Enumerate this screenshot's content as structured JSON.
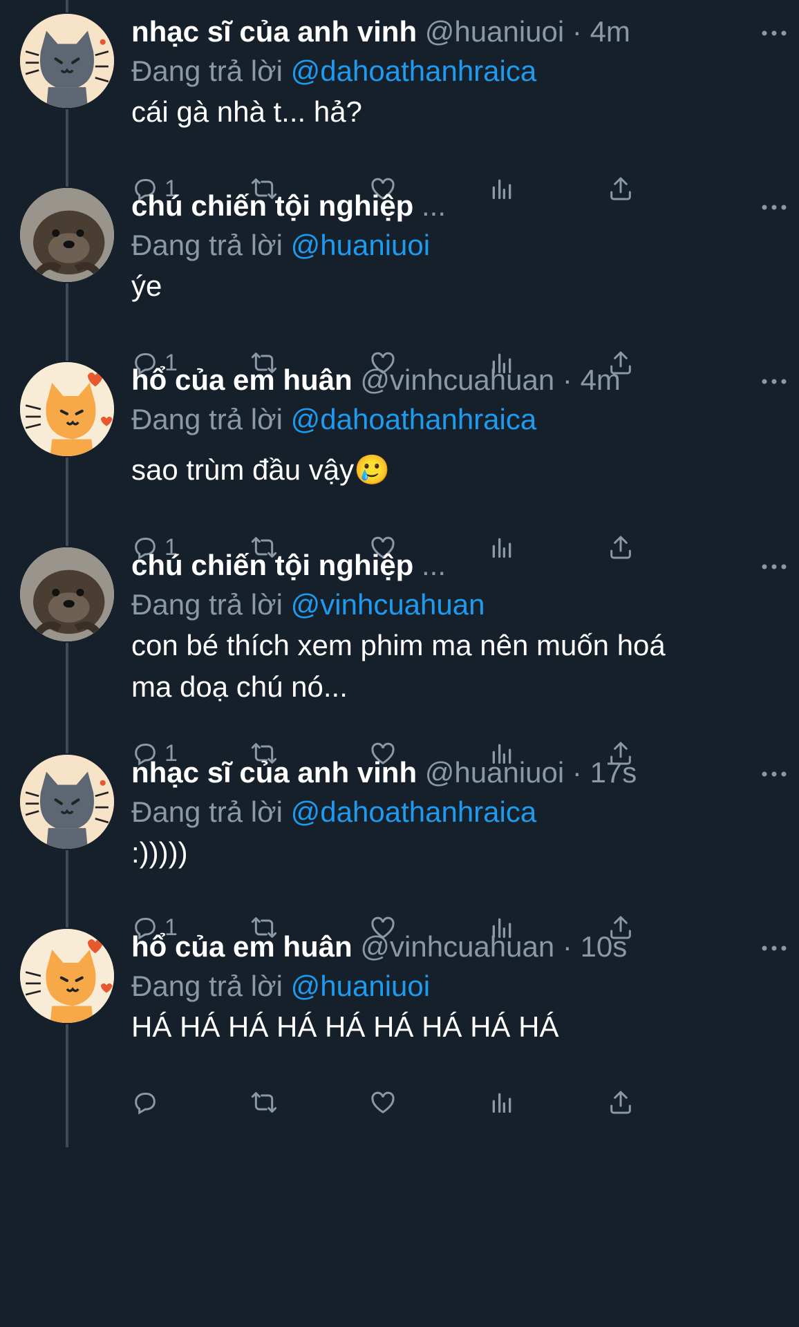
{
  "theme": {
    "background": "#15202b",
    "text": "#ffffff",
    "muted": "#8b98a5",
    "link": "#1d9bf0"
  },
  "tweets": [
    {
      "display_name": "nhạc sĩ của anh vinh",
      "handle": "@huaniuoi",
      "separator": "·",
      "time": "4m",
      "reply_prefix": "Đang trả lời",
      "reply_to": "@dahoathanhraica",
      "lines": [
        "cái gà nhà t... hả?"
      ],
      "reply_count": "1",
      "avatar": "gray-cat-avatar"
    },
    {
      "display_name": "chú chiến tội nghiệp",
      "handle": "...",
      "separator": "",
      "time": "",
      "reply_prefix": "Đang trả lời",
      "reply_to": "@huaniuoi",
      "lines": [
        "ýe"
      ],
      "reply_count": "1",
      "avatar": "otter-avatar"
    },
    {
      "display_name": "hổ của em huân",
      "handle": "@vinhcuahuan",
      "separator": "·",
      "time": "4m",
      "reply_prefix": "Đang trả lời",
      "reply_to": "@dahoathanhraica",
      "lines": [
        "sao trùm đầu vậy🥲"
      ],
      "reply_count": "1",
      "avatar": "orange-cat-avatar"
    },
    {
      "display_name": "chú chiến tội nghiệp",
      "handle": "...",
      "separator": "",
      "time": "",
      "reply_prefix": "Đang trả lời",
      "reply_to": "@vinhcuahuan",
      "lines": [
        "con bé thích xem phim ma nên muốn hoá",
        "ma doạ chú nó..."
      ],
      "reply_count": "1",
      "avatar": "otter-avatar"
    },
    {
      "display_name": "nhạc sĩ của anh vinh",
      "handle": "@huaniuoi",
      "separator": "·",
      "time": "17s",
      "reply_prefix": "Đang trả lời",
      "reply_to": "@dahoathanhraica",
      "lines": [
        ":)))))"
      ],
      "reply_count": "1",
      "avatar": "gray-cat-avatar"
    },
    {
      "display_name": "hổ của em huân",
      "handle": "@vinhcuahuan",
      "separator": "·",
      "time": "10s",
      "reply_prefix": "Đang trả lời",
      "reply_to": "@huaniuoi",
      "lines": [
        "HÁ HÁ HÁ HÁ HÁ HÁ HÁ HÁ HÁ"
      ],
      "reply_count": "",
      "avatar": "orange-cat-avatar"
    }
  ]
}
